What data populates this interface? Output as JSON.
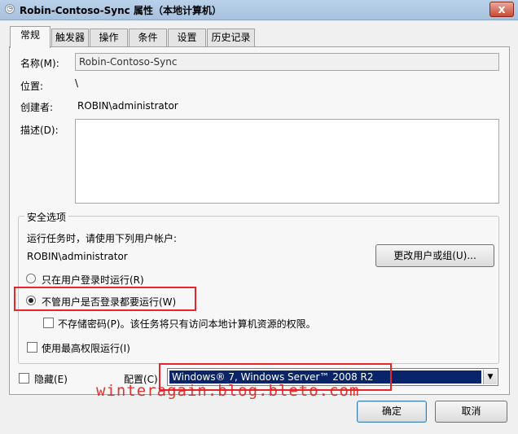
{
  "window": {
    "title": "Robin-Contoso-Sync 属性（本地计算机）",
    "close_glyph": "x"
  },
  "tabs": [
    {
      "label": "常规",
      "active": true
    },
    {
      "label": "触发器",
      "active": false
    },
    {
      "label": "操作",
      "active": false
    },
    {
      "label": "条件",
      "active": false
    },
    {
      "label": "设置",
      "active": false
    },
    {
      "label": "历史记录",
      "active": false
    }
  ],
  "general": {
    "name_label": "名称(M):",
    "name_value": "Robin-Contoso-Sync",
    "location_label": "位置:",
    "location_value": "\\",
    "author_label": "创建者:",
    "author_value": "ROBIN\\administrator",
    "description_label": "描述(D):",
    "description_value": ""
  },
  "security": {
    "group_title": "安全选项",
    "run_as_prompt": "运行任务时，请使用下列用户帐户:",
    "user_account": "ROBIN\\administrator",
    "change_user_button": "更改用户或组(U)...",
    "radio_logged_on": "只在用户登录时运行(R)",
    "radio_always": "不管用户是否登录都要运行(W)",
    "radio_selected": "always",
    "no_store_password": "不存储密码(P)。该任务将只有访问本地计算机资源的权限。",
    "no_store_password_checked": false,
    "highest_privileges": "使用最高权限运行(I)",
    "highest_privileges_checked": false
  },
  "footer": {
    "hidden_label": "隐藏(E)",
    "hidden_checked": false,
    "config_label": "配置(C):",
    "config_value": "Windows® 7, Windows Server™ 2008 R2",
    "ok_button": "确定",
    "cancel_button": "取消"
  },
  "watermark": "winteragain.blog.bleto.com",
  "colors": {
    "highlight_red": "#e8252a",
    "select_highlight": "#0a246a"
  }
}
